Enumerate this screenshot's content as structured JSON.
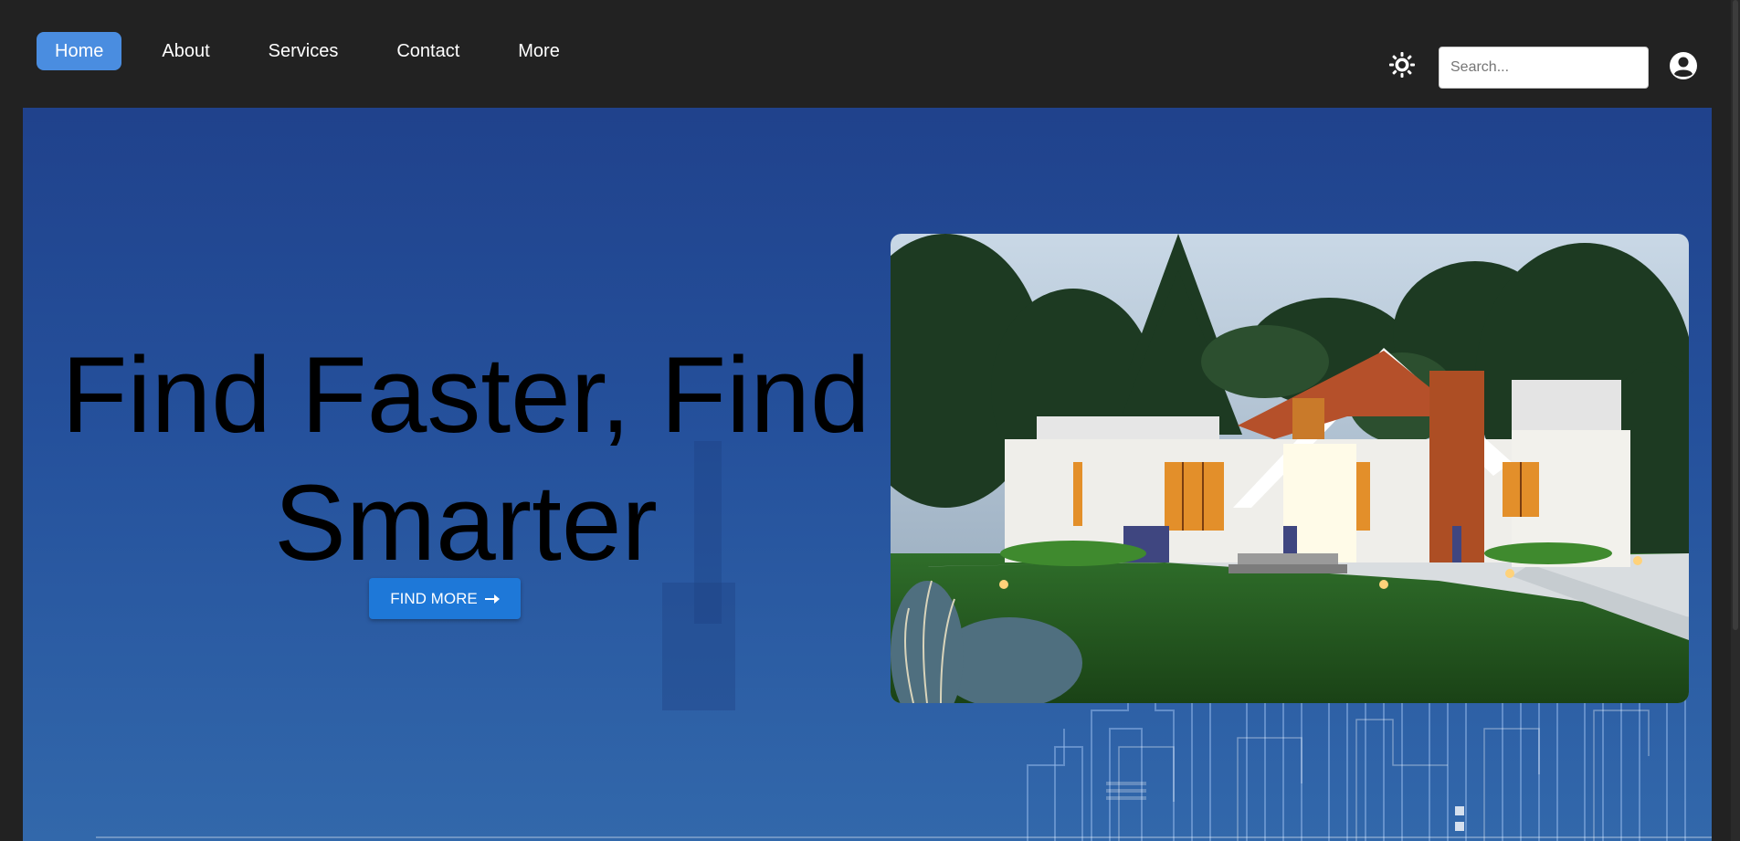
{
  "nav": {
    "items": [
      {
        "label": "Home",
        "active": true
      },
      {
        "label": "About",
        "active": false
      },
      {
        "label": "Services",
        "active": false
      },
      {
        "label": "Contact",
        "active": false
      },
      {
        "label": "More",
        "active": false
      }
    ]
  },
  "header": {
    "theme_icon": "sun-icon",
    "search_placeholder": "Search...",
    "search_value": "",
    "account_icon": "user-circle-icon"
  },
  "hero": {
    "title": "Find Faster, Find Smarter",
    "button_label": "FIND MORE",
    "button_icon": "arrow-right-icon",
    "image": "house-photo"
  },
  "colors": {
    "nav_background": "#222222",
    "nav_active": "#4a8de0",
    "hero_gradient_top": "#20428c",
    "hero_gradient_bottom": "#3268ab",
    "button": "#1e78d8"
  }
}
